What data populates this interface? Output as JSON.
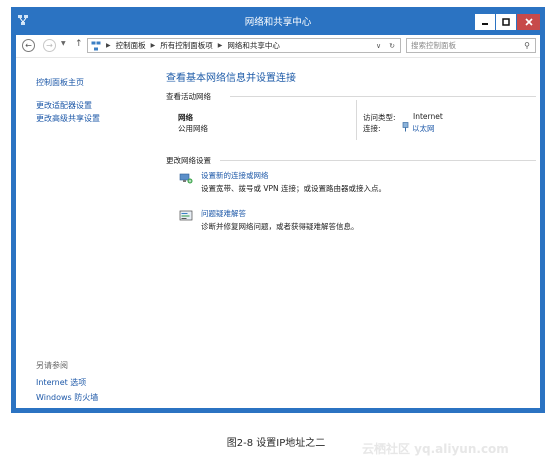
{
  "window": {
    "title": "网络和共享中心"
  },
  "address_bar": {
    "crumbs": [
      "控制面板",
      "所有控制面板项",
      "网络和共享中心"
    ],
    "search_placeholder": "搜索控制面板"
  },
  "sidebar": {
    "home": "控制面板主页",
    "links": [
      "更改适配器设置",
      "更改高级共享设置"
    ],
    "see_also_title": "另请参阅",
    "see_also": [
      "Internet 选项",
      "Windows 防火墙"
    ]
  },
  "main": {
    "title": "查看基本网络信息并设置连接",
    "active_networks_header": "查看活动网络",
    "network_name": "网络",
    "network_type": "公用网络",
    "access_type_label": "访问类型:",
    "access_type_value": "Internet",
    "connections_label": "连接:",
    "connections_value": "以太网",
    "change_settings_header": "更改网络设置",
    "tasks": [
      {
        "link": "设置新的连接或网络",
        "desc": "设置宽带、拨号或 VPN 连接；或设置路由器或接入点。"
      },
      {
        "link": "问题疑难解答",
        "desc": "诊断并修复网络问题，或者获得疑难解答信息。"
      }
    ]
  },
  "caption": "图2-8 设置IP地址之二",
  "watermark": "云栖社区 yq.aliyun.com"
}
